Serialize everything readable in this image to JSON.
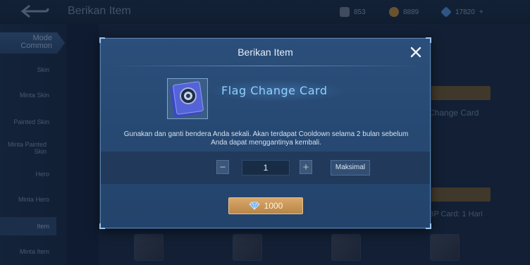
{
  "background": {
    "page_title": "Berikan Item",
    "currencies": [
      {
        "icon": "ticket-icon",
        "value": "853",
        "color": "#8a9bb0"
      },
      {
        "icon": "coin-icon",
        "value": "8889",
        "color": "#b88a3c"
      },
      {
        "icon": "diamond-icon",
        "value": "17820",
        "color": "#4d8fd8"
      }
    ],
    "currency_more": "+",
    "mode_tab": {
      "line1": "Mode",
      "line2": "Common"
    },
    "sidebar_items": [
      "Skin",
      "Minta Skin",
      "Painted Skin",
      "Minta Painted Skin",
      "Hero",
      "Minta Hero",
      "Item",
      "Minta Item"
    ],
    "active_sidebar_index": 6,
    "right_labels": {
      "card_name": "Change Card",
      "bp_card": "BP Card: 1 Hari"
    }
  },
  "dialog": {
    "title": "Berikan Item",
    "item_name": "Flag Change Card",
    "description": "Gunakan dan ganti bendera Anda sekali. Akan terdapat Cooldown selama 2 bulan sebelum Anda dapat menggantinya kembali.",
    "quantity": "1",
    "minus_label": "−",
    "plus_label": "+",
    "max_label": "Maksimal",
    "price": "1000",
    "accent_color": "#8fd0ff"
  }
}
